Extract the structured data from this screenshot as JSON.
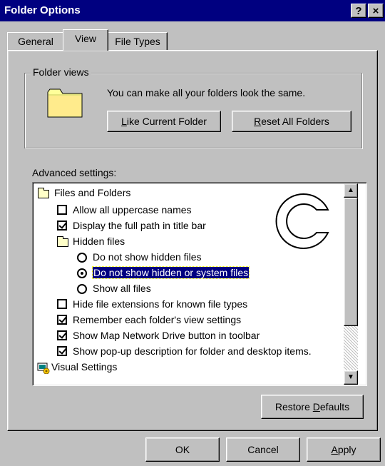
{
  "window": {
    "title": "Folder Options",
    "help_button": "?",
    "close_button": "×"
  },
  "tabs": [
    {
      "label": "General"
    },
    {
      "label": "View"
    },
    {
      "label": "File Types"
    }
  ],
  "folder_views": {
    "legend": "Folder views",
    "description": "You can make all your folders look the same.",
    "like_current_button": {
      "pre": "",
      "key": "L",
      "post": "ike Current Folder"
    },
    "reset_all_button": {
      "pre": "",
      "key": "R",
      "post": "eset All Folders"
    }
  },
  "advanced": {
    "label": "Advanced settings:",
    "items": [
      {
        "label": "Files and Folders",
        "type": "folder"
      },
      {
        "label": "Allow all uppercase names",
        "type": "checkbox",
        "checked": false
      },
      {
        "label": "Display the full path in title bar",
        "type": "checkbox",
        "checked": true
      },
      {
        "label": "Hidden files",
        "type": "folder"
      },
      {
        "label": "Do not show hidden files",
        "type": "radio",
        "checked": false
      },
      {
        "label": "Do not show hidden or system files",
        "type": "radio",
        "checked": true
      },
      {
        "label": "Show all files",
        "type": "radio",
        "checked": false
      },
      {
        "label": "Hide file extensions for known file types",
        "type": "checkbox",
        "checked": false
      },
      {
        "label": "Remember each folder's view settings",
        "type": "checkbox",
        "checked": true
      },
      {
        "label": "Show Map Network Drive button in toolbar",
        "type": "checkbox",
        "checked": true
      },
      {
        "label": "Show pop-up description for folder and desktop items.",
        "type": "checkbox",
        "checked": true
      },
      {
        "label": "Visual Settings",
        "type": "settings"
      }
    ],
    "restore_button": {
      "pre": "Restore ",
      "key": "D",
      "post": "efaults"
    }
  },
  "watermark": "C",
  "footer": {
    "ok_label": "OK",
    "cancel_label": "Cancel",
    "apply_button": {
      "pre": "",
      "key": "A",
      "post": "pply"
    }
  },
  "colors": {
    "titlebar": "#000080",
    "face": "#c0c0c0",
    "selection": "#000080"
  }
}
